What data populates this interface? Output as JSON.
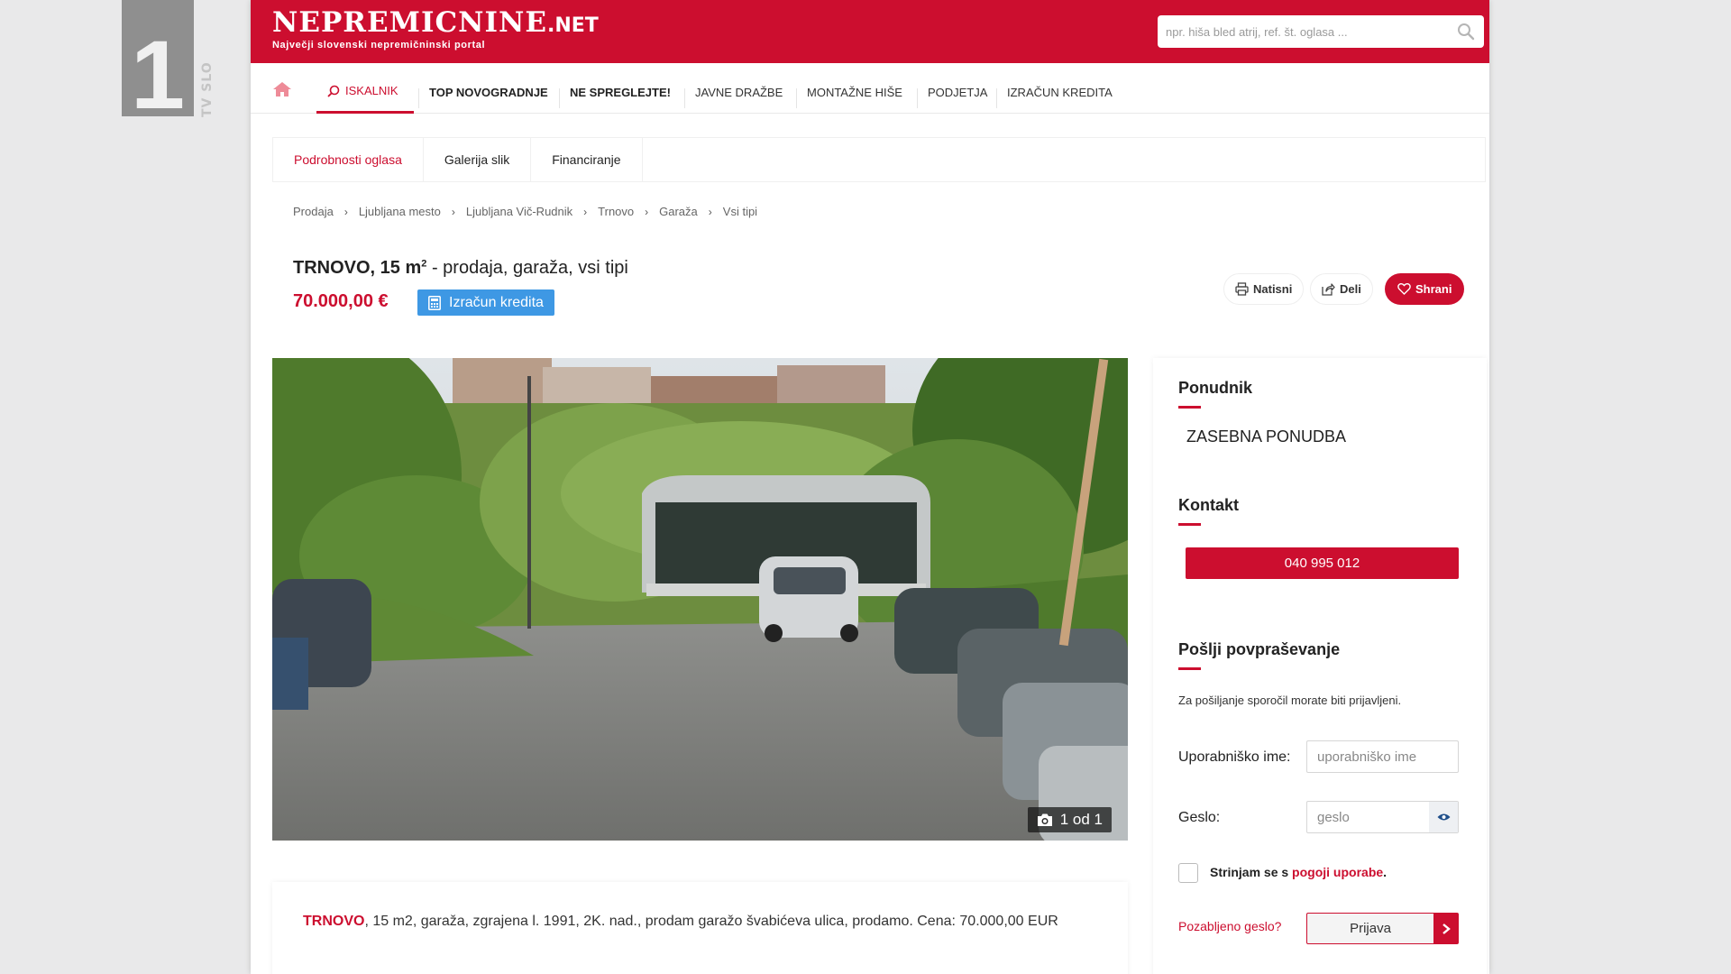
{
  "tv_logo": {
    "number": "1",
    "sub": "TV SLO"
  },
  "site": {
    "logo_main": "NEPREMICNINE",
    "logo_net": ".NET",
    "tagline": "Največji slovenski nepremičninski portal",
    "search_placeholder": "npr. hiša bled atrij, ref. št. oglasa ..."
  },
  "nav": {
    "items": [
      {
        "label": "ISKALNIK"
      },
      {
        "label": "TOP NOVOGRADNJE"
      },
      {
        "label": "NE SPREGLEJTE!"
      },
      {
        "label": "JAVNE DRAŽBE"
      },
      {
        "label": "MONTAŽNE HIŠE"
      },
      {
        "label": "PODJETJA"
      },
      {
        "label": "IZRAČUN KREDITA"
      }
    ]
  },
  "subtabs": [
    {
      "label": "Podrobnosti oglasa"
    },
    {
      "label": "Galerija slik"
    },
    {
      "label": "Financiranje"
    }
  ],
  "breadcrumb": [
    "Prodaja",
    "Ljubljana mesto",
    "Ljubljana Vič-Rudnik",
    "Trnovo",
    "Garaža",
    "Vsi tipi"
  ],
  "listing": {
    "title_bold": "TRNOVO, 15 m",
    "title_sup": "2",
    "title_rest": " - prodaja, garaža, vsi tipi",
    "price": "70.000,00 €",
    "calc_label": "Izračun kredita",
    "print_label": "Natisni",
    "share_label": "Deli",
    "save_label": "Shrani",
    "photo_counter": "1 od 1",
    "desc_highlight": "TRNOVO",
    "desc_text": ", 15 m2, garaža, zgrajena l. 1991, 2K. nad., prodam garažo švabićeva ulica, prodamo. Cena: 70.000,00 EUR"
  },
  "sidebar": {
    "offerer_title": "Ponudnik",
    "offerer_value": "ZASEBNA PONUDBA",
    "contact_title": "Kontakt",
    "phone": "040 995 012",
    "inquiry_title": "Pošlji povpraševanje",
    "login_note": "Za pošiljanje sporočil morate biti prijavljeni.",
    "username_label": "Uporabniško ime:",
    "username_placeholder": "uporabniško ime",
    "password_label": "Geslo:",
    "password_placeholder": "geslo",
    "terms_prefix": "Strinjam se s ",
    "terms_link": "pogoji uporabe",
    "terms_suffix": ".",
    "forgot_label": "Pozabljeno geslo?",
    "login_label": "Prijava"
  },
  "colors": {
    "brand": "#cc0e2f",
    "accent_blue": "#3e98e4"
  }
}
